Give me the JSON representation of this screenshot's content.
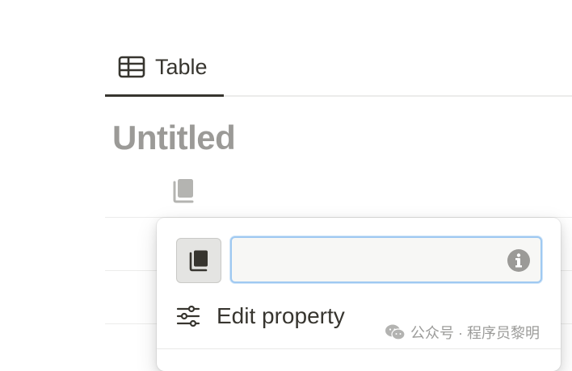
{
  "view_tab": {
    "label": "Table",
    "icon": "table-icon"
  },
  "page": {
    "title": "Untitled"
  },
  "property": {
    "icon": "page-icon"
  },
  "property_menu": {
    "icon_button": "page-icon",
    "name_input": {
      "value": "",
      "placeholder": ""
    },
    "info_icon": "info-icon",
    "edit_property_label": "Edit property"
  },
  "watermark": {
    "icon": "wechat-icon",
    "text": "公众号 · 程序员黎明"
  },
  "colors": {
    "text": "#37352f",
    "muted_title": "#9b9a97",
    "focus_ring": "#9fc9f1",
    "input_bg": "#f7f7f5",
    "watermark": "#9c9c9a"
  }
}
